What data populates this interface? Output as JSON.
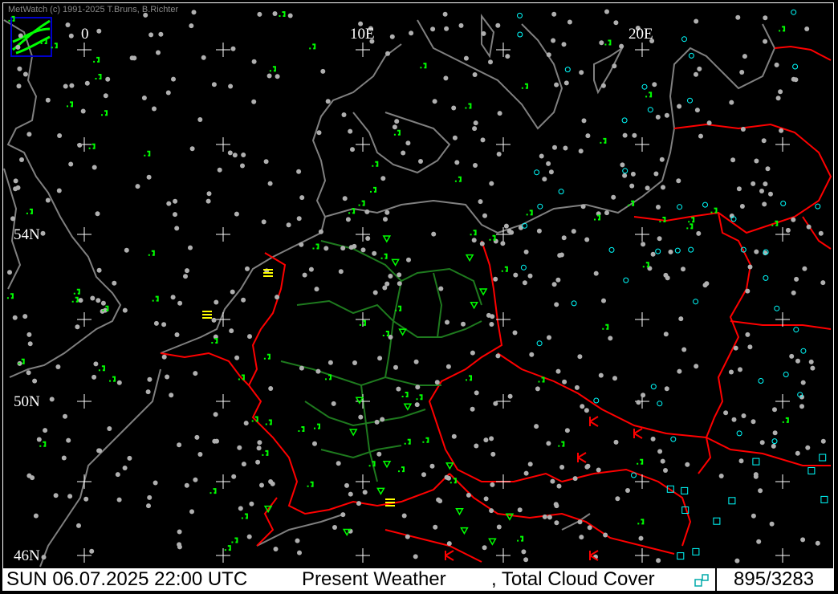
{
  "window": {
    "copyright": "MetWatch  (c) 1991-2025 T.Bruns, B.Richter"
  },
  "grid_labels": {
    "lon_0": "0",
    "lon_10": "10E",
    "lon_20": "20E",
    "lat_54": "54N",
    "lat_50": "50N",
    "lat_46": "46N"
  },
  "status": {
    "datetime": "SUN 06.07.2025 22:00 UTC",
    "layer1": "Present Weather",
    "layer2": ", Total Cloud Cover",
    "count": "895/3283"
  },
  "colors": {
    "background": "#000000",
    "coast": "#808080",
    "border": "#ff0000",
    "german_states": "#1e7a1e",
    "rain_symbol": "#00ff00",
    "thunder_symbol": "#ff0000",
    "fog_symbol": "#ffff00",
    "cloud_cover": "#00ffff",
    "station": "#b0b0b0",
    "grid_cross": "#ffffff"
  },
  "legend": {
    "icon": "cloud-cover-legend-icon"
  }
}
